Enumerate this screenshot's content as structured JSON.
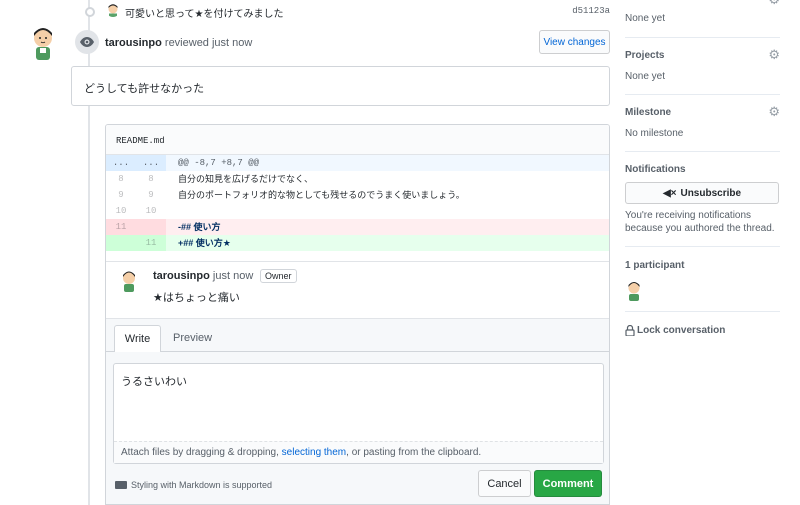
{
  "commit": {
    "message": "可愛いと思って★を付けてみました",
    "sha": "d51123a"
  },
  "review": {
    "author": "tarousinpo",
    "action": "reviewed just now",
    "view_changes_label": "View changes",
    "body": "どうしても許せなかった"
  },
  "file": {
    "name": "README.md",
    "rows": [
      {
        "type": "hunk",
        "old": "...",
        "new": "...",
        "code": "@@ -8,7 +8,7 @@"
      },
      {
        "type": "ctx",
        "old": "8",
        "new": "8",
        "code": "自分の知見を広げるだけでなく、"
      },
      {
        "type": "ctx",
        "old": "9",
        "new": "9",
        "code": "自分のポートフォリオ的な物としても残せるのでうまく使いましょう。"
      },
      {
        "type": "ctx",
        "old": "10",
        "new": "10",
        "code": ""
      },
      {
        "type": "del",
        "old": "11",
        "new": "",
        "code": "-## 使い方"
      },
      {
        "type": "add",
        "old": "",
        "new": "11",
        "code": "+## 使い方★"
      }
    ]
  },
  "inline_comment": {
    "author": "tarousinpo",
    "time": "just now",
    "badge": "Owner",
    "body": "★はちょっと痛い"
  },
  "editor": {
    "tab_write": "Write",
    "tab_preview": "Preview",
    "text": "うるさいわい",
    "attach_prefix": "Attach files by dragging & dropping, ",
    "attach_link": "selecting them",
    "attach_suffix": ", or pasting from the clipboard.",
    "markdown_note": "Styling with Markdown is supported",
    "cancel_label": "Cancel",
    "comment_label": "Comment"
  },
  "sidebar": {
    "labels_none": "None yet",
    "projects_title": "Projects",
    "projects_none": "None yet",
    "milestone_title": "Milestone",
    "milestone_none": "No milestone",
    "notifications_title": "Notifications",
    "unsubscribe_label": "Unsubscribe",
    "notifications_note": "You're receiving notifications because you authored the thread.",
    "participants_title": "1 participant",
    "lock_label": "Lock conversation"
  },
  "colors": {
    "link": "#0366d6",
    "green": "#28a745",
    "hunk_bg": "#f1f8ff",
    "del_bg": "#ffeef0",
    "add_bg": "#e6ffed"
  }
}
